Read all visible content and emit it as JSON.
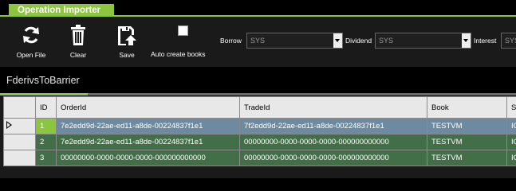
{
  "window": {
    "title": "Operation Importer"
  },
  "toolbar": {
    "open_label": "Open File",
    "clear_label": "Clear",
    "save_label": "Save",
    "auto_create_label": "Auto create books",
    "auto_create_checked": false,
    "borrow_label": "Borrow",
    "borrow_value": "SYS",
    "dividend_label": "Dividend",
    "dividend_value": "SYS",
    "interest_label": "Interest",
    "interest_value": "SYS"
  },
  "section": {
    "title": "FderivsToBarrier"
  },
  "grid": {
    "columns": [
      "ID",
      "OrderId",
      "TradeId",
      "Book",
      "St"
    ],
    "rows": [
      {
        "id": "1",
        "order_id": "7e2edd9d-22ae-ed11-a8de-00224837f1e1",
        "trade_id": "7f2edd9d-22ae-ed11-a8de-00224837f1e1",
        "book": "TESTVM",
        "status": "IC"
      },
      {
        "id": "2",
        "order_id": "7e2edd9d-22ae-ed11-a8de-00224837f1e1",
        "trade_id": "00000000-0000-0000-0000-000000000000",
        "book": "TESTVM",
        "status": "IC"
      },
      {
        "id": "3",
        "order_id": "00000000-0000-0000-0000-000000000000",
        "trade_id": "00000000-0000-0000-0000-000000000000",
        "book": "TESTVM",
        "status": "IC"
      }
    ]
  },
  "colors": {
    "accent": "#8cc63e",
    "selected_row": "#6d8aa0",
    "row": "#426f47"
  }
}
